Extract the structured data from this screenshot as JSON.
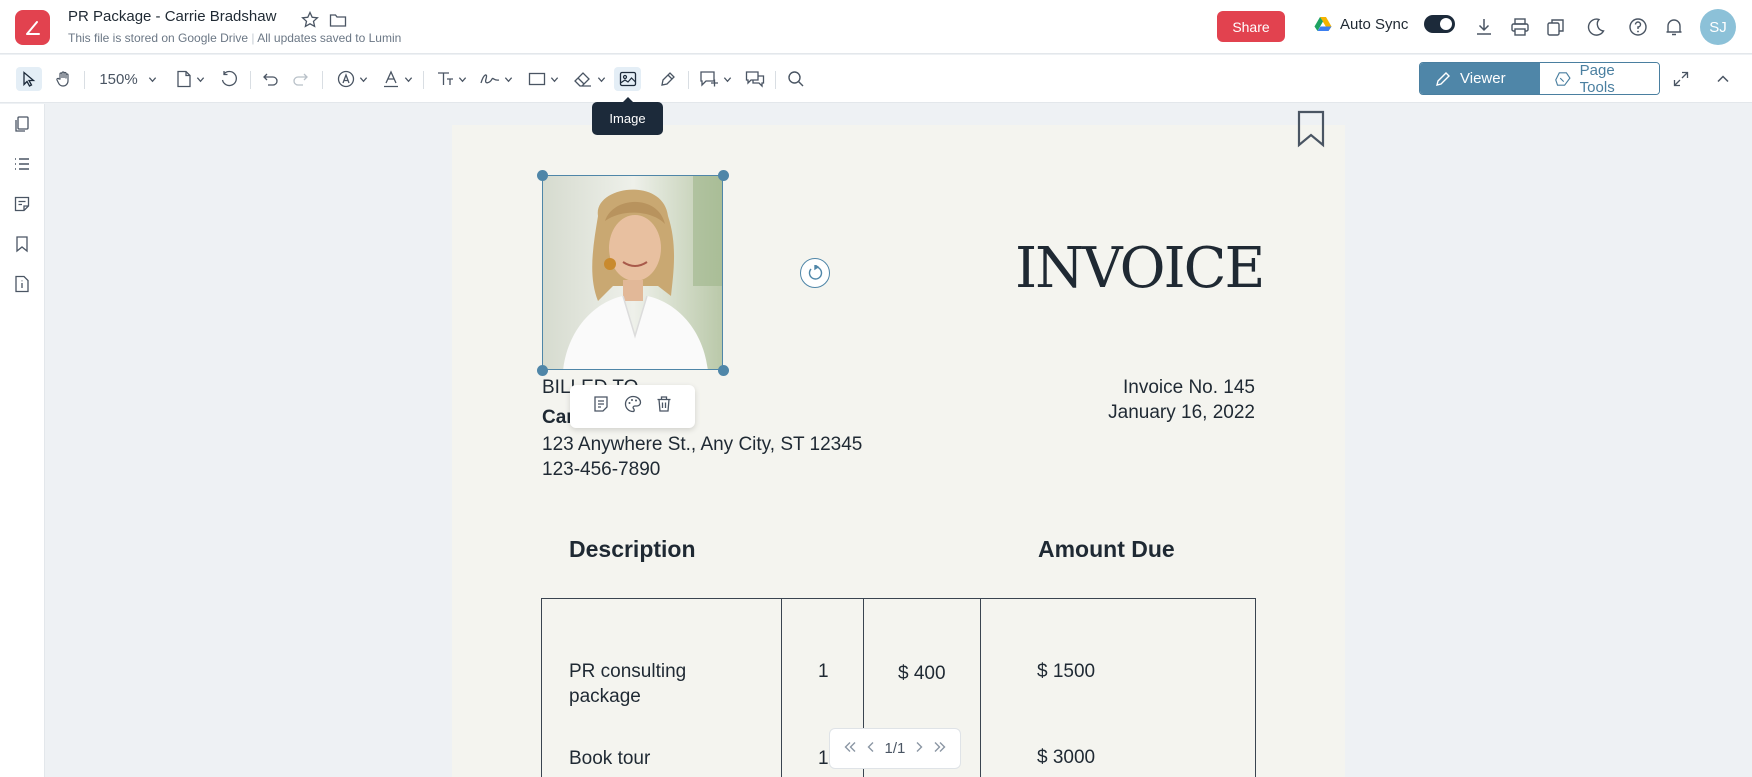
{
  "app": {
    "title": "PR Package - Carrie Bradshaw",
    "storage_note": "This file is stored on Google Drive",
    "save_status": "All updates saved to Lumin"
  },
  "header": {
    "share_label": "Share",
    "autosync_label": "Auto Sync",
    "autosync_on": true,
    "avatar_initials": "SJ"
  },
  "toolbar": {
    "zoom": "150%",
    "viewer_label": "Viewer",
    "page_tools_label": "Page Tools",
    "tooltip": "Image"
  },
  "document": {
    "heading": "INVOICE",
    "billed_to_label": "BILLED TO",
    "client_name": "Carrie Bradshaw",
    "address": "123 Anywhere St., Any City, ST 12345",
    "phone": "123-456-7890",
    "invoice_no": "Invoice No. 145",
    "invoice_date": "January 16, 2022",
    "col_description": "Description",
    "col_amount": "Amount Due",
    "rows": [
      {
        "description_line1": "PR consulting",
        "description_line2": "package",
        "qty": "1",
        "price": "$ 400",
        "amount": "$ 1500"
      },
      {
        "description_line1": "Book tour",
        "description_line2": "",
        "qty": "1",
        "price": "",
        "amount": "$ 3000"
      }
    ]
  },
  "pager": {
    "current": "1/1"
  },
  "colors": {
    "brand": "#e2424f",
    "accent": "#4f86a8",
    "dark": "#1c2a3a"
  }
}
